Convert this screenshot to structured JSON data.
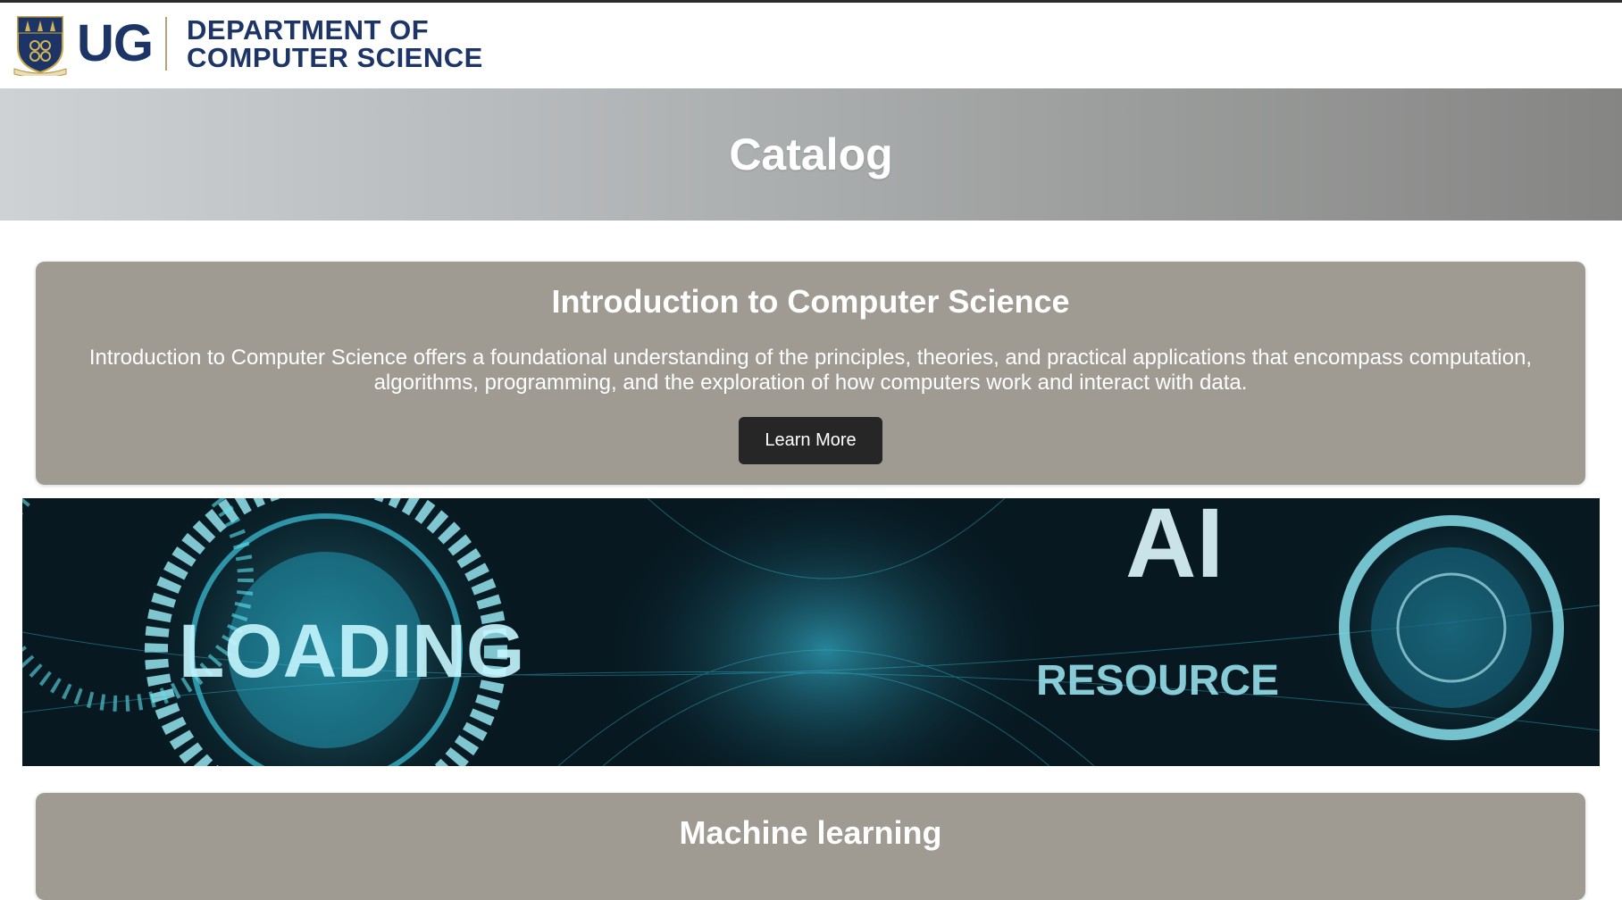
{
  "header": {
    "logo_short": "UG",
    "logo_line1": "DEPARTMENT OF",
    "logo_line2": "COMPUTER SCIENCE"
  },
  "banner": {
    "title": "Catalog"
  },
  "courses": [
    {
      "title": "Introduction to Computer Science",
      "description": "Introduction to Computer Science offers a foundational understanding of the principles, theories, and practical applications that encompass computation, algorithms, programming, and the exploration of how computers work and interact with data.",
      "button_label": "Learn More"
    },
    {
      "title": "Machine learning"
    }
  ],
  "feature_image": {
    "text_loading": "LOADING",
    "text_ai": "AI",
    "text_resource": "RESOURCE"
  },
  "colors": {
    "brand_navy": "#1c3566",
    "card_bg": "#9f9a92",
    "button_bg": "#262626",
    "image_cyan": "#3fd6e6"
  }
}
